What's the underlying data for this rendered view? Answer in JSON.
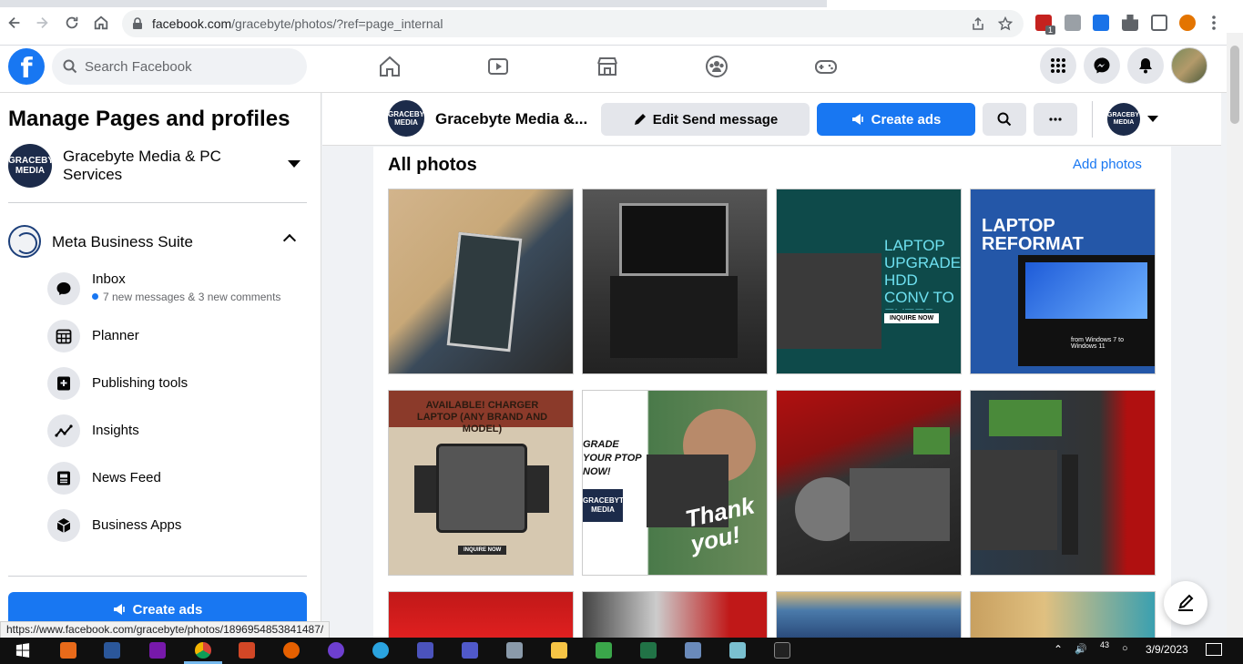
{
  "browser": {
    "url_host": "facebook.com",
    "url_path": "/gracebyte/photos/?ref=page_internal",
    "ext_badge": "1"
  },
  "topbar": {
    "logo_letter": "f",
    "search_placeholder": "Search Facebook"
  },
  "sidebar": {
    "title": "Manage Pages and profiles",
    "page_name": "Gracebyte Media & PC Services",
    "page_logo_text": "GRACEBYTE MEDIA",
    "suite_label": "Meta Business Suite",
    "items": [
      {
        "label": "Inbox",
        "sub": "7 new messages & 3 new comments",
        "icon": "inbox-icon"
      },
      {
        "label": "Planner",
        "icon": "calendar-icon"
      },
      {
        "label": "Publishing tools",
        "icon": "publishing-icon"
      },
      {
        "label": "Insights",
        "icon": "insights-icon"
      },
      {
        "label": "News Feed",
        "icon": "news-feed-icon"
      },
      {
        "label": "Business Apps",
        "icon": "cube-icon"
      }
    ],
    "create_ads": "Create ads"
  },
  "page_header": {
    "name": "Gracebyte Media &...",
    "edit_send": "Edit Send message",
    "create_ads": "Create ads"
  },
  "photos": {
    "title": "All photos",
    "add": "Add photos",
    "overlays": {
      "p3": "LAPTOP UPGRADE HDD CONV TO EXTER",
      "p3_cta": "INQUIRE NOW",
      "p4": "LAPTOP REFORMAT",
      "p4_sub": "from Windows 7 to Windows 11",
      "p5": "AVAILABLE! CHARGER LAPTOP (ANY BRAND AND MODEL)",
      "p5_cta": "INQUIRE NOW",
      "p6_a": "GRADE YOUR PTOP NOW!",
      "p6_logo": "GRACEBYTE MEDIA",
      "p6_thanks": "Thank you!"
    }
  },
  "status_url": "https://www.facebook.com/gracebyte/photos/1896954853841487/",
  "taskbar": {
    "tray_temp": "43",
    "date": "3/9/2023"
  },
  "colors": {
    "fb_blue": "#1877f2",
    "bg": "#f0f2f5"
  }
}
